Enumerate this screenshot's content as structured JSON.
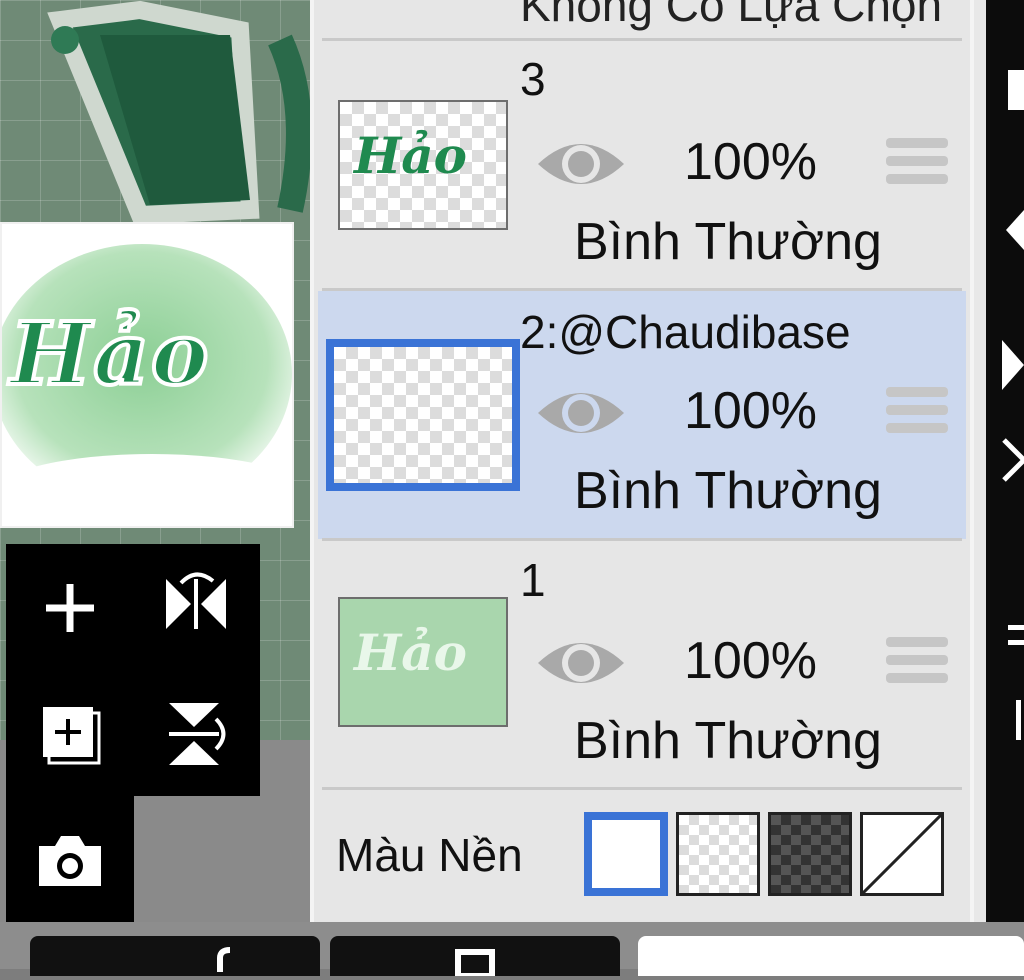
{
  "top_cut_text": "Không Có Lựa Chọn",
  "layers": [
    {
      "name": "3",
      "opacity": "100%",
      "mode": "Bình Thường",
      "selected": false
    },
    {
      "name": "2:@Chaudibase",
      "opacity": "100%",
      "mode": "Bình Thường",
      "selected": true
    },
    {
      "name": "1",
      "opacity": "100%",
      "mode": "Bình Thường",
      "selected": false
    }
  ],
  "background": {
    "label": "Màu Nền",
    "options": [
      "white",
      "transparent",
      "dark-checker",
      "none"
    ],
    "selected": "white"
  },
  "preview_text": "Hảo",
  "colors": {
    "accent": "#3a73d6",
    "selected_row": "#ccd8ee",
    "panel": "#e6e6e6",
    "brush_green": "#1f8a4f"
  }
}
